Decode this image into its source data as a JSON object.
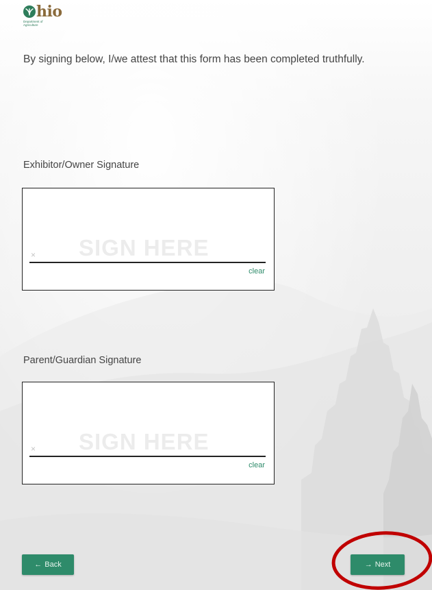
{
  "logo": {
    "word": "hio",
    "subtitle_line1": "Department of",
    "subtitle_line2": "Agriculture",
    "brand_color": "#2e7d5b",
    "word_color": "#8a6a3b"
  },
  "attestation_text": "By signing below, I/we attest that this form has been completed truthfully.",
  "signatures": [
    {
      "label": "Exhibitor/Owner Signature",
      "watermark": "SIGN HERE",
      "x_mark": "×",
      "clear_label": "clear"
    },
    {
      "label": "Parent/Guardian Signature",
      "watermark": "SIGN HERE",
      "x_mark": "×",
      "clear_label": "clear"
    }
  ],
  "nav": {
    "back_arrow": "←",
    "back_label": "Back",
    "next_arrow": "→",
    "next_label": "Next",
    "button_color": "#2e8b6a"
  },
  "annotation": {
    "shape": "ellipse",
    "color": "#c00000",
    "highlights": "next-button"
  }
}
